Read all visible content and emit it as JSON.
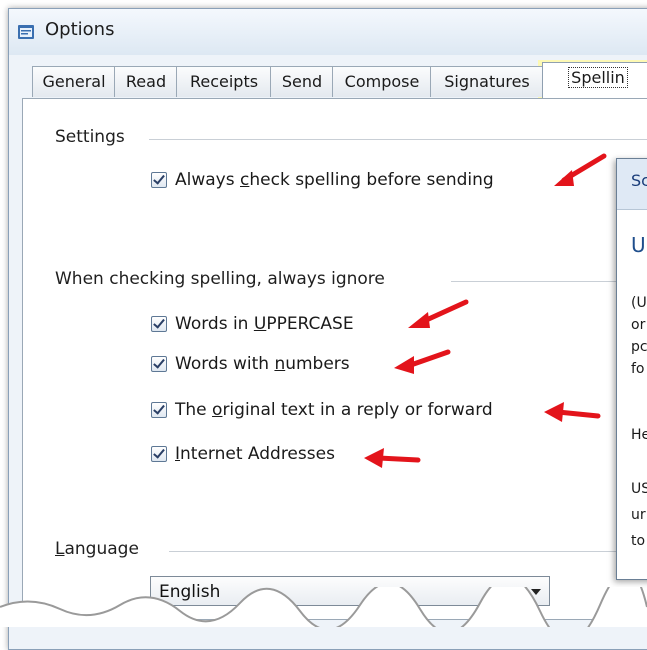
{
  "window": {
    "title": "Options"
  },
  "tabs": [
    {
      "label": "General"
    },
    {
      "label": "Read"
    },
    {
      "label": "Receipts"
    },
    {
      "label": "Send"
    },
    {
      "label": "Compose"
    },
    {
      "label": "Signatures"
    },
    {
      "label": "Spellin",
      "active": true
    }
  ],
  "settings": {
    "heading": "Settings",
    "always_check": {
      "label_pre": "Always ",
      "label_accel": "c",
      "label_post": "heck spelling before sending",
      "checked": true
    }
  },
  "ignore": {
    "heading": "When checking spelling, always ignore",
    "items": [
      {
        "pre": "Words in ",
        "accel": "U",
        "post": "PPERCASE",
        "checked": true
      },
      {
        "pre": "Words with ",
        "accel": "n",
        "post": "umbers",
        "checked": true
      },
      {
        "pre": "The ",
        "accel": "o",
        "post": "riginal text in a reply or forward",
        "checked": true
      },
      {
        "pre": "",
        "accel": "I",
        "post": "nternet Addresses",
        "checked": true
      }
    ]
  },
  "language": {
    "heading_accel": "L",
    "heading_rest": "anguage",
    "selected": "English"
  },
  "popup": {
    "header": "Sc",
    "title": "U",
    "lines": [
      "(U",
      "or",
      "pc",
      "fo",
      "He",
      "US",
      "ur",
      "to"
    ]
  },
  "colors": {
    "highlight": "#fff9a8",
    "arrow": "#e3141b"
  },
  "icons": {
    "window": "options-window-icon",
    "arrows": "red-annotation-arrow"
  }
}
